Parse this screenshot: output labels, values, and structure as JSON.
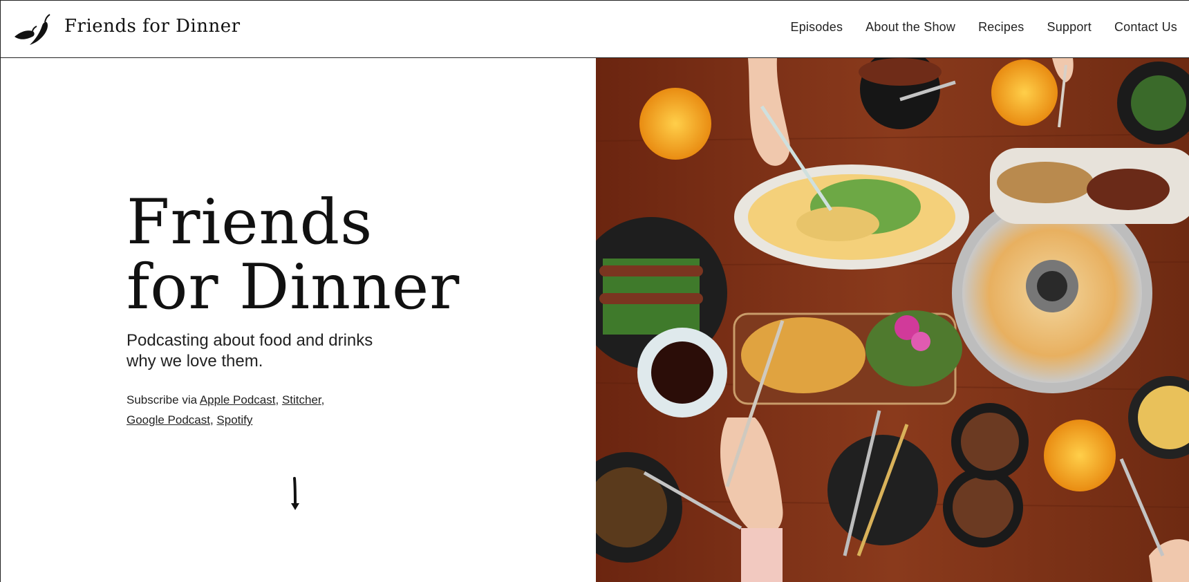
{
  "header": {
    "site_title": "Friends for Dinner",
    "logo_icon": "chili-peppers-icon",
    "nav": [
      "Episodes",
      "About the Show",
      "Recipes",
      "Support",
      "Contact Us"
    ]
  },
  "hero": {
    "title_line1": "Friends",
    "title_line2": "for Dinner",
    "tagline_line1": "Podcasting about food and drinks",
    "tagline_line2": "why we love them.",
    "subscribe_prefix": "Subscribe via ",
    "links": [
      "Apple Podcast",
      "Stitcher",
      "Google Podcast",
      "Spotify"
    ],
    "scroll_icon": "arrow-down-icon"
  },
  "colors": {
    "text": "#111111",
    "background": "#ffffff",
    "table_wood": "#7a2f16"
  }
}
